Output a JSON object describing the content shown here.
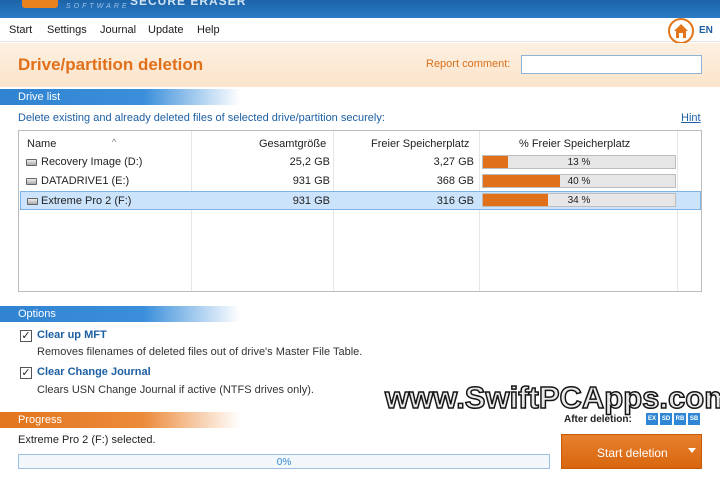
{
  "window": {
    "brand_main": "SECURE ERASER",
    "brand_sub": "SOFTWARE"
  },
  "menu": {
    "items": [
      "Start",
      "Settings",
      "Journal",
      "Update",
      "Help"
    ],
    "language": "EN",
    "home_icon": "home-icon"
  },
  "header": {
    "title": "Drive/partition deletion",
    "report_label": "Report comment:",
    "report_value": ""
  },
  "drive_list": {
    "section_title": "Drive list",
    "description": "Delete existing and already deleted files of selected drive/partition securely:",
    "hint_link": "Hint",
    "columns": [
      "Name",
      "Gesamtgröße",
      "Freier Speicherplatz",
      "% Freier Speicherplatz"
    ],
    "rows": [
      {
        "name": "Recovery Image (D:)",
        "total": "25,2 GB",
        "free": "3,27 GB",
        "percent_label": "13 %",
        "percent": 13,
        "selected": false
      },
      {
        "name": "DATADRIVE1 (E:)",
        "total": "931 GB",
        "free": "368 GB",
        "percent_label": "40 %",
        "percent": 40,
        "selected": false
      },
      {
        "name": "Extreme Pro 2 (F:)",
        "total": "931 GB",
        "free": "316 GB",
        "percent_label": "34 %",
        "percent": 34,
        "selected": true
      }
    ]
  },
  "options": {
    "section_title": "Options",
    "items": [
      {
        "title": "Clear up MFT",
        "description": "Removes filenames of deleted files out of drive's Master File Table.",
        "checked": true
      },
      {
        "title": "Clear Change Journal",
        "description": "Clears USN Change Journal if active (NTFS drives only).",
        "checked": true
      }
    ]
  },
  "progress": {
    "section_title": "Progress",
    "status": "Extreme Pro 2 (F:) selected.",
    "value_label": "0%",
    "value": 0
  },
  "after_deletion": {
    "label": "After deletion:",
    "badges": [
      "EX",
      "SD",
      "RB",
      "SB"
    ]
  },
  "start_button": {
    "label": "Start deletion"
  },
  "watermark": "www.SwiftPCApps.com",
  "colors": {
    "accent_orange": "#e0701a",
    "accent_blue": "#2f83d0",
    "selected_row": "#cce4fb"
  }
}
